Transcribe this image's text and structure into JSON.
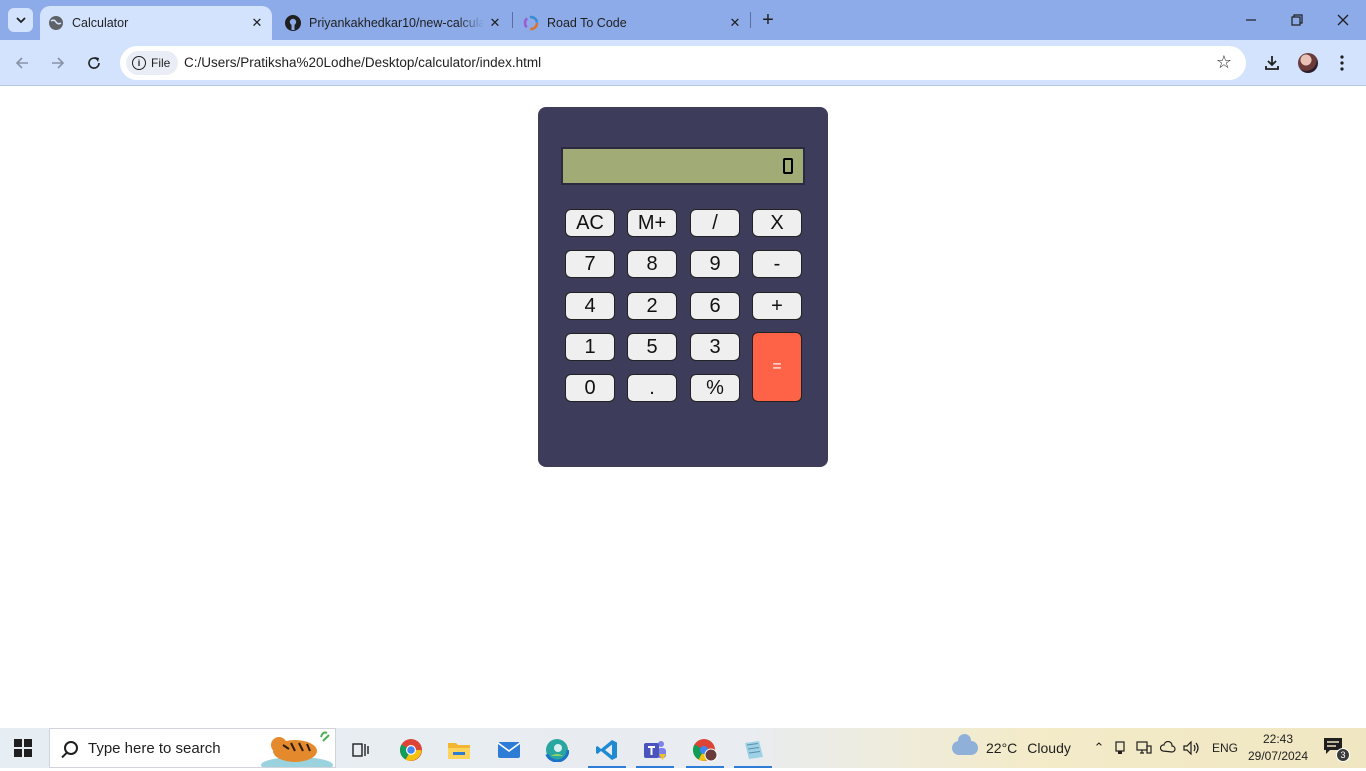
{
  "browser": {
    "tabs": [
      {
        "title": "Calculator",
        "active": true,
        "icon": "globe-icon"
      },
      {
        "title": "Priyankakhedkar10/new-calcula",
        "active": false,
        "icon": "github-icon"
      },
      {
        "title": "Road To Code",
        "active": false,
        "icon": "rainbow-ring-icon"
      }
    ],
    "address": {
      "scheme_label": "File",
      "url": "C:/Users/Pratiksha%20Lodhe/Desktop/calculator/index.html"
    }
  },
  "calculator": {
    "display_value": "",
    "keys": [
      {
        "label": "AC",
        "name": "key-clear"
      },
      {
        "label": "M+",
        "name": "key-memory-plus"
      },
      {
        "label": "/",
        "name": "key-divide"
      },
      {
        "label": "X",
        "name": "key-multiply"
      },
      {
        "label": "7",
        "name": "key-7"
      },
      {
        "label": "8",
        "name": "key-8"
      },
      {
        "label": "9",
        "name": "key-9"
      },
      {
        "label": "-",
        "name": "key-subtract"
      },
      {
        "label": "4",
        "name": "key-4"
      },
      {
        "label": "2",
        "name": "key-2"
      },
      {
        "label": "6",
        "name": "key-6"
      },
      {
        "label": "+",
        "name": "key-add"
      },
      {
        "label": "1",
        "name": "key-1"
      },
      {
        "label": "5",
        "name": "key-5"
      },
      {
        "label": "3",
        "name": "key-3"
      },
      {
        "label": "0",
        "name": "key-0"
      },
      {
        "label": ".",
        "name": "key-decimal"
      },
      {
        "label": "%",
        "name": "key-percent"
      }
    ],
    "equals_label": "=",
    "colors": {
      "body": "#3d3c5a",
      "display": "#a1ab75",
      "equals": "#ff6347",
      "key": "#efefef"
    }
  },
  "taskbar": {
    "search_placeholder": "Type here to search",
    "weather": {
      "temp": "22°C",
      "condition": "Cloudy"
    },
    "language": "ENG",
    "time": "22:43",
    "date": "29/07/2024",
    "notification_count": "3"
  }
}
